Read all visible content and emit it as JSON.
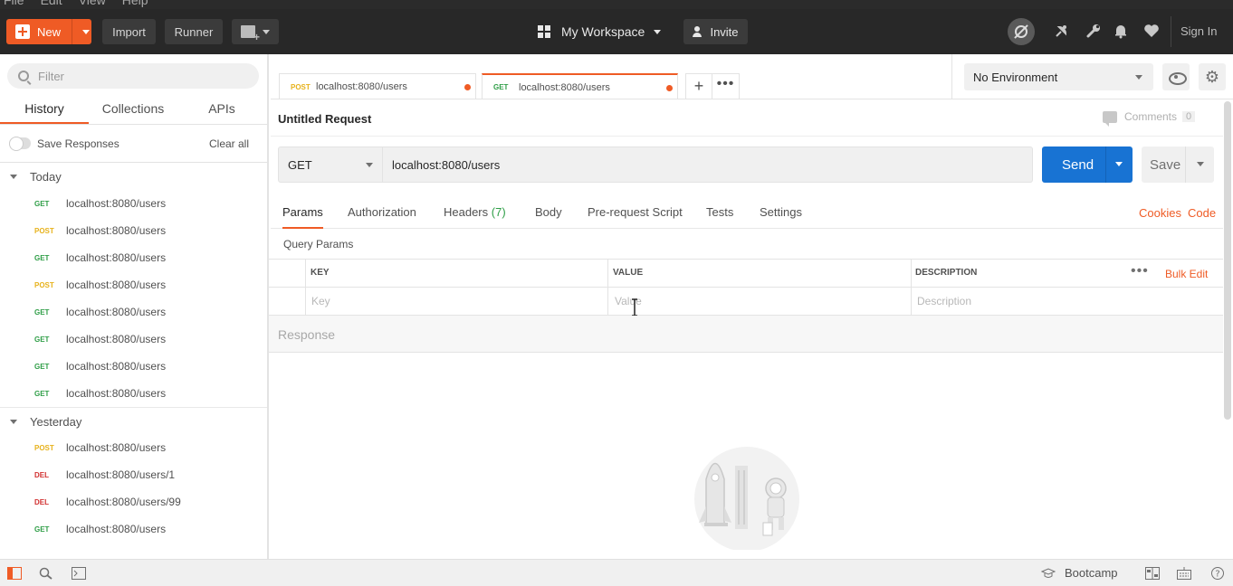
{
  "menubar": {
    "items": [
      "File",
      "Edit",
      "View",
      "Help"
    ]
  },
  "header": {
    "new_label": "New",
    "import_label": "Import",
    "runner_label": "Runner",
    "workspace_label": "My Workspace",
    "invite_label": "Invite",
    "signin_label": "Sign In"
  },
  "sidebar": {
    "filter_placeholder": "Filter",
    "tabs": [
      "History",
      "Collections",
      "APIs"
    ],
    "active_tab": "History",
    "save_responses_label": "Save Responses",
    "clear_all_label": "Clear all",
    "groups": [
      {
        "label": "Today",
        "items": [
          {
            "method": "GET",
            "url": "localhost:8080/users"
          },
          {
            "method": "POST",
            "url": "localhost:8080/users"
          },
          {
            "method": "GET",
            "url": "localhost:8080/users"
          },
          {
            "method": "POST",
            "url": "localhost:8080/users"
          },
          {
            "method": "GET",
            "url": "localhost:8080/users"
          },
          {
            "method": "GET",
            "url": "localhost:8080/users"
          },
          {
            "method": "GET",
            "url": "localhost:8080/users"
          },
          {
            "method": "GET",
            "url": "localhost:8080/users"
          }
        ]
      },
      {
        "label": "Yesterday",
        "items": [
          {
            "method": "POST",
            "url": "localhost:8080/users"
          },
          {
            "method": "DEL",
            "url": "localhost:8080/users/1"
          },
          {
            "method": "DEL",
            "url": "localhost:8080/users/99"
          },
          {
            "method": "GET",
            "url": "localhost:8080/users"
          }
        ]
      }
    ]
  },
  "request_tabs": [
    {
      "method": "POST",
      "url": "localhost:8080/users",
      "active": false,
      "unsaved": true
    },
    {
      "method": "GET",
      "url": "localhost:8080/users",
      "active": true,
      "unsaved": true
    }
  ],
  "environment": {
    "selected": "No Environment"
  },
  "request": {
    "title": "Untitled Request",
    "comments_label": "Comments",
    "comments_count": "0",
    "method": "GET",
    "url": "localhost:8080/users",
    "send_label": "Send",
    "save_label": "Save",
    "tabs": [
      "Params",
      "Authorization",
      "Headers",
      "Body",
      "Pre-request Script",
      "Tests",
      "Settings"
    ],
    "headers_count": "(7)",
    "active_tab": "Params",
    "cookies_label": "Cookies",
    "code_label": "Code"
  },
  "query_params": {
    "label": "Query Params",
    "columns": [
      "KEY",
      "VALUE",
      "DESCRIPTION"
    ],
    "bulk_edit_label": "Bulk Edit",
    "placeholders": {
      "key": "Key",
      "value": "Value",
      "description": "Description"
    }
  },
  "response": {
    "label": "Response"
  },
  "statusbar": {
    "bootcamp_label": "Bootcamp"
  },
  "colors": {
    "accent": "#ef5b25",
    "send": "#1873d3",
    "get": "#2f9e47",
    "post": "#e7b21c",
    "del": "#d12f2f"
  }
}
